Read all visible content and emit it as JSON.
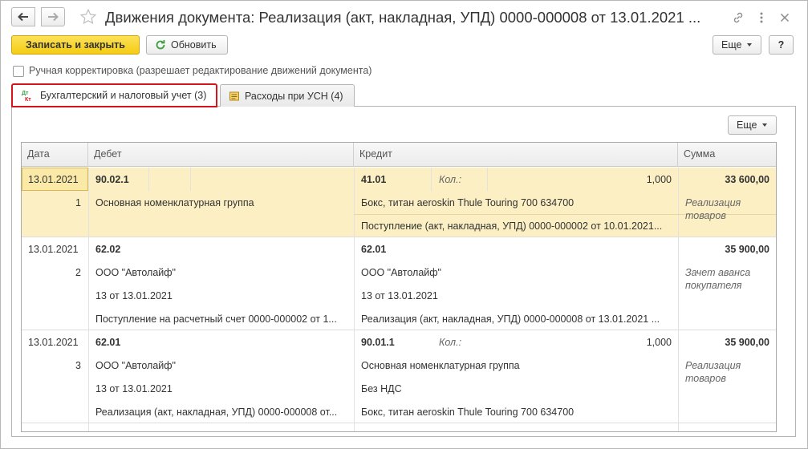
{
  "window": {
    "title": "Движения документа: Реализация (акт, накладная, УПД) 0000-000008 от 13.01.2021 ..."
  },
  "toolbar": {
    "save_close_label": "Записать и закрыть",
    "refresh_label": "Обновить",
    "more_label": "Еще",
    "help_label": "?"
  },
  "manual_correction": {
    "label": "Ручная корректировка (разрешает редактирование движений документа)",
    "checked": false
  },
  "tabs": [
    {
      "icon_text": "Дт Кт",
      "label": "Бухгалтерский и налоговый учет (3)",
      "active": true
    },
    {
      "label": "Расходы при УСН (4)",
      "active": false
    }
  ],
  "panel": {
    "more_label": "Еще"
  },
  "table": {
    "columns": [
      "Дата",
      "Дебет",
      "Кредит",
      "Сумма"
    ],
    "rows": [
      {
        "date": "13.01.2021",
        "num": "1",
        "debit_account": "90.02.1",
        "debit_lines": [
          "Основная номенклатурная группа"
        ],
        "credit_account": "41.01",
        "credit_qty_label": "Кол.:",
        "credit_qty": "1,000",
        "credit_lines": [
          "Бокс, титан aeroskin Thule Touring 700 634700",
          "Поступление (акт, накладная, УПД) 0000-000002 от 10.01.2021..."
        ],
        "amount": "33 600,00",
        "amount_note": "Реализация товаров"
      },
      {
        "date": "13.01.2021",
        "num": "2",
        "debit_account": "62.02",
        "debit_lines": [
          "ООО \"Автолайф\"",
          "13 от 13.01.2021",
          "Поступление на расчетный счет 0000-000002 от 1..."
        ],
        "credit_account": "62.01",
        "credit_lines": [
          "ООО \"Автолайф\"",
          "13 от 13.01.2021",
          "Реализация (акт, накладная, УПД) 0000-000008 от 13.01.2021 ..."
        ],
        "amount": "35 900,00",
        "amount_note": "Зачет аванса покупателя"
      },
      {
        "date": "13.01.2021",
        "num": "3",
        "debit_account": "62.01",
        "debit_lines": [
          "ООО \"Автолайф\"",
          "13 от 13.01.2021",
          "Реализация (акт, накладная, УПД) 0000-000008 от..."
        ],
        "credit_account": "90.01.1",
        "credit_qty_label": "Кол.:",
        "credit_qty": "1,000",
        "credit_lines": [
          "Основная номенклатурная группа",
          "Без НДС",
          "Бокс, титан aeroskin Thule Touring 700 634700"
        ],
        "amount": "35 900,00",
        "amount_note": "Реализация товаров"
      }
    ]
  },
  "colors": {
    "primary_button": "#f5cc13",
    "selected_row": "#fbefc3",
    "active_tab_border": "#d6141b"
  }
}
